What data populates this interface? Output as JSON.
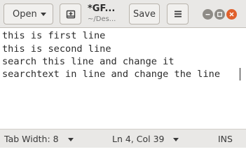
{
  "header": {
    "open_label": "Open",
    "title": "*GF...",
    "subtitle": "~/Des...",
    "save_label": "Save"
  },
  "icons": {
    "open_dropdown": "chevron-down-icon",
    "new_tab": "new-tab-icon",
    "menu": "hamburger-menu-icon",
    "minimize": "minimize-icon",
    "maximize": "maximize-icon",
    "close": "close-icon"
  },
  "colors": {
    "header_bg": "#e9e8e6",
    "close_button": "#e0602c",
    "window_button": "#8e8b86"
  },
  "editor": {
    "lines": [
      "this is first line",
      "this is second line",
      "search this line and change it",
      "searchtext in line and change the line"
    ]
  },
  "statusbar": {
    "tab_width": "Tab Width: 8",
    "position": "Ln 4, Col 39",
    "mode": "INS"
  }
}
